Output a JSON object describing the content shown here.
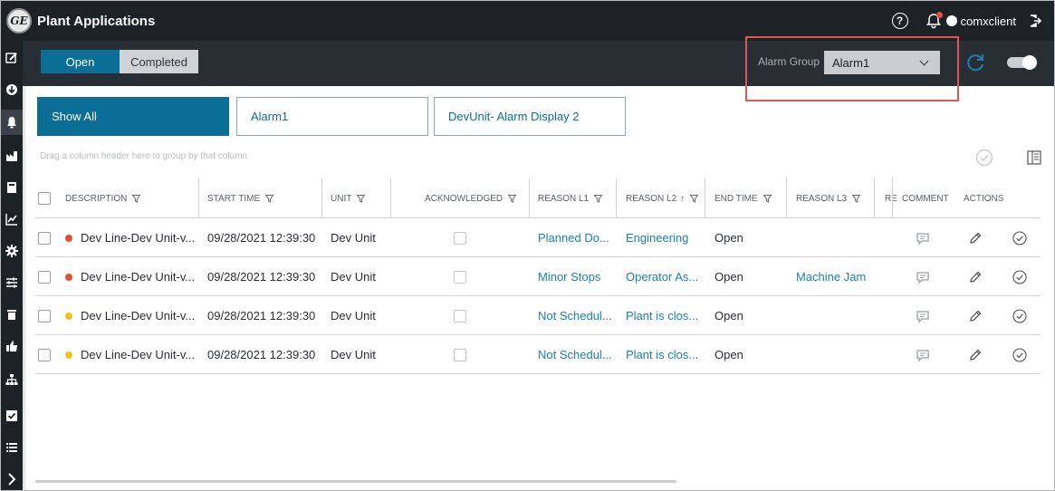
{
  "app": {
    "title": "Plant Applications",
    "logo_text": "GE",
    "username": "comxclient"
  },
  "toolbar": {
    "tabs": [
      {
        "label": "Open",
        "active": true
      },
      {
        "label": "Completed",
        "active": false
      }
    ],
    "alarm_group_label": "Alarm Group",
    "alarm_group_value": "Alarm1"
  },
  "filters": [
    {
      "label": "Show All",
      "active": true
    },
    {
      "label": "Alarm1",
      "active": false
    },
    {
      "label": "DevUnit- Alarm Display 2",
      "active": false
    }
  ],
  "grid": {
    "drag_hint": "Drag a column header here to group by that column",
    "columns": {
      "description": "DESCRIPTION",
      "start_time": "START TIME",
      "unit": "UNIT",
      "acknowledged": "ACKNOWLEDGED",
      "reason_l1": "REASON L1",
      "reason_l2": "REASON L2",
      "reason_l2_sort": "↑",
      "end_time": "END TIME",
      "reason_l3": "REASON L3",
      "reason_l4": "RE",
      "comment": "COMMENT",
      "actions": "ACTIONS"
    },
    "rows": [
      {
        "severity_color": "#e4502f",
        "description": "Dev Line-Dev Unit-v...",
        "start_time": "09/28/2021 12:39:30",
        "unit": "Dev Unit",
        "reason_l1": "Planned Do...",
        "reason_l2": "Engineering",
        "end_time": "Open",
        "reason_l3": ""
      },
      {
        "severity_color": "#e4502f",
        "description": "Dev Line-Dev Unit-v...",
        "start_time": "09/28/2021 12:39:30",
        "unit": "Dev Unit",
        "reason_l1": "Minor Stops",
        "reason_l2": "Operator As...",
        "end_time": "Open",
        "reason_l3": "Machine Jam"
      },
      {
        "severity_color": "#f2c21a",
        "description": "Dev Line-Dev Unit-v...",
        "start_time": "09/28/2021 12:39:30",
        "unit": "Dev Unit",
        "reason_l1": "Not Schedul...",
        "reason_l2": "Plant is clos...",
        "end_time": "Open",
        "reason_l3": ""
      },
      {
        "severity_color": "#f2c21a",
        "description": "Dev Line-Dev Unit-v...",
        "start_time": "09/28/2021 12:39:30",
        "unit": "Dev Unit",
        "reason_l1": "Not Schedul...",
        "reason_l2": "Plant is clos...",
        "end_time": "Open",
        "reason_l3": ""
      }
    ]
  },
  "colors": {
    "accent": "#0b6e96",
    "topbar": "#1d2226",
    "toolbar": "#272e34",
    "link": "#1b7fb5",
    "highlight": "#e55353"
  }
}
